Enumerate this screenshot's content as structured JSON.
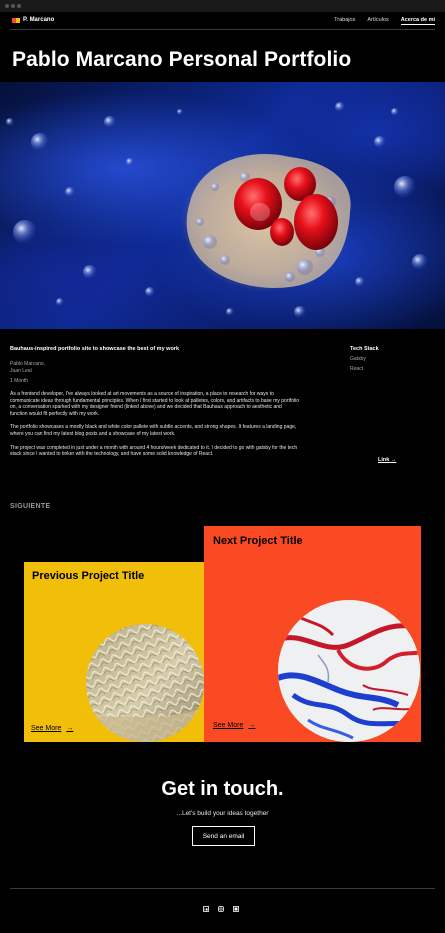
{
  "nav": {
    "brand": "P. Marcano",
    "links": [
      "Trabajos",
      "Artículos",
      "Acerca de mi"
    ],
    "active_index": 2
  },
  "page": {
    "title": "Pablo Marcano Personal Portfolio"
  },
  "project": {
    "heading": "Bauhaus-inspired portfolio site to showcase the best of my work",
    "authors": [
      "Pablo Marcano,",
      "Juan Leal"
    ],
    "duration": "1 Month",
    "paragraphs": [
      "As a frontend developer, I've always looked at art movements as a source of inspiration, a place to research for ways to communicate ideas through fundamental principles. When I first started to look at palletes, colors, and artifacts to base my portfolio on, a conversation sparked with my designer friend (linked above) and we decided that Bauhaus approach to aesthetic and function would fit perfectly with my work.",
      "The portfolio showcases a mostly black and white color pallete with subtle accents, and strong shapes. It features a landing page, where you can find my latest blog posts and a showcase of my latest work.",
      "The project was completed in just under a month with around 4 hours/week dedicated to it. I decided to go with gatsby for the tech stack since I wanted to tinker with the technology, and have some solid knowledge of React."
    ],
    "stack_title": "Tech Stack",
    "stack": [
      "Gatsby",
      "React"
    ],
    "link_label": "Link",
    "link_arrow": "→"
  },
  "next_section": {
    "label": "SIGUIENTE",
    "prev": {
      "title": "Previous Project Title",
      "see_more": "See More",
      "arrow": "→",
      "color": "#f1bf0a"
    },
    "next": {
      "title": "Next Project Title",
      "see_more": "See More",
      "arrow": "→",
      "color": "#fa4a24"
    }
  },
  "contact": {
    "title": "Get in touch.",
    "subtitle": "...Let's build your ideas together",
    "button": "Send an email"
  },
  "footer": {
    "socials": [
      "linkedin-icon",
      "instagram-icon",
      "github-icon"
    ]
  }
}
